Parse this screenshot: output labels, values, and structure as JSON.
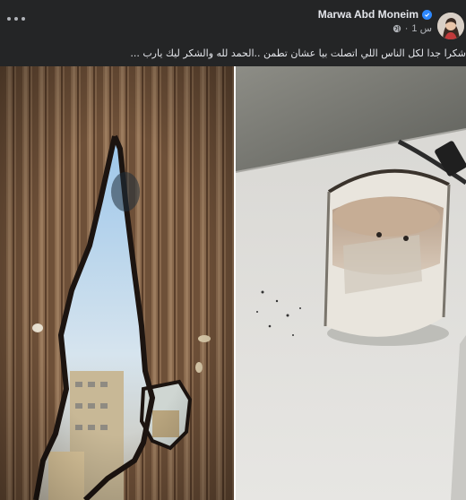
{
  "post": {
    "author": "Marwa Abd Moneim",
    "time": "1 س",
    "separator": "·",
    "caption": "شكرا جدا لكل الناس اللي اتصلت بيا عشان تطمن ..الحمد لله والشكر ليك يارب ..."
  },
  "icons": {
    "more": "more-options-icon",
    "verified": "verified-badge-icon",
    "privacy": "globe-icon"
  },
  "photos": [
    {
      "subject": "burned-curtain-photo"
    },
    {
      "subject": "melted-candle-photo"
    }
  ],
  "colors": {
    "background": "#242526",
    "text": "#e4e6eb",
    "muted": "#b0b3b8",
    "verified": "#2d88ff"
  }
}
